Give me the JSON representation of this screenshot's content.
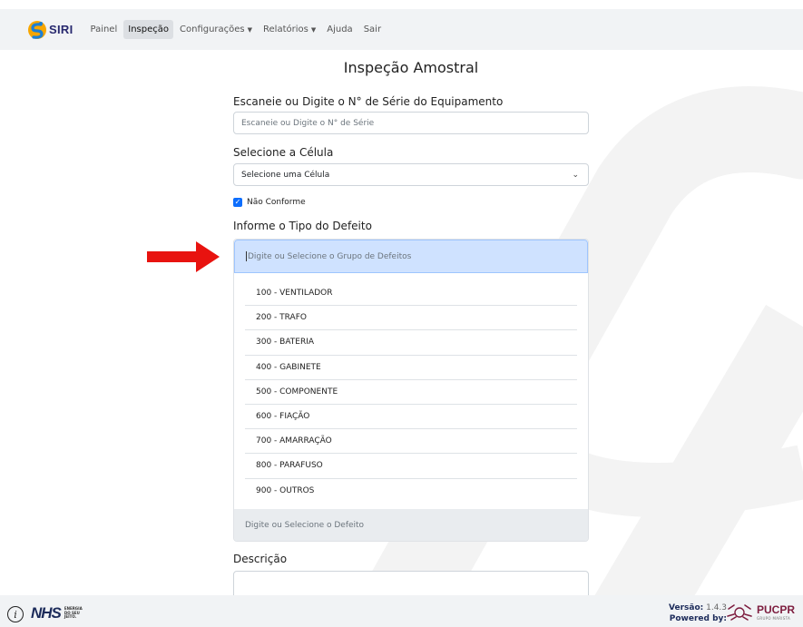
{
  "nav": {
    "brand": "SIRI",
    "items": [
      {
        "label": "Painel",
        "active": false,
        "dropdown": false
      },
      {
        "label": "Inspeção",
        "active": true,
        "dropdown": false
      },
      {
        "label": "Configurações",
        "active": false,
        "dropdown": true
      },
      {
        "label": "Relatórios",
        "active": false,
        "dropdown": true
      },
      {
        "label": "Ajuda",
        "active": false,
        "dropdown": false
      },
      {
        "label": "Sair",
        "active": false,
        "dropdown": false
      }
    ]
  },
  "page": {
    "title": "Inspeção Amostral",
    "serial_label": "Escaneie ou Digite o N° de Série do Equipamento",
    "serial_placeholder": "Escaneie ou Digite o N° de Série",
    "cell_label": "Selecione a Célula",
    "cell_value": "Selecione uma Célula",
    "nonconform_label": "Não Conforme",
    "nonconform_checked": true,
    "defect_label": "Informe o Tipo do Defeito",
    "defect_group_placeholder": "Digite ou Selecione o Grupo de Defeitos",
    "defect_groups": [
      "100 - VENTILADOR",
      "200 - TRAFO",
      "300 - BATERIA",
      "400 - GABINETE",
      "500 - COMPONENTE",
      "600 - FIAÇÃO",
      "700 - AMARRAÇÃO",
      "800 - PARAFUSO",
      "900 - OUTROS"
    ],
    "defect_placeholder": "Digite ou Selecione o Defeito",
    "description_label": "Descrição"
  },
  "footer": {
    "nhs_logo": "NHS",
    "nhs_tagline": [
      "ENERGIA",
      "DO SEU",
      "JEITO."
    ],
    "version_label": "Versão:",
    "version_value": "1.4.3",
    "powered_by": "Powered by:",
    "pucpr_logo": "PUCPR",
    "pucpr_sub": "GRUPO MARISTA"
  },
  "colors": {
    "accent": "#0d6efd",
    "focus_bg": "#cfe2ff",
    "arrow": "#e8130f",
    "brand_navy": "#27286e"
  }
}
